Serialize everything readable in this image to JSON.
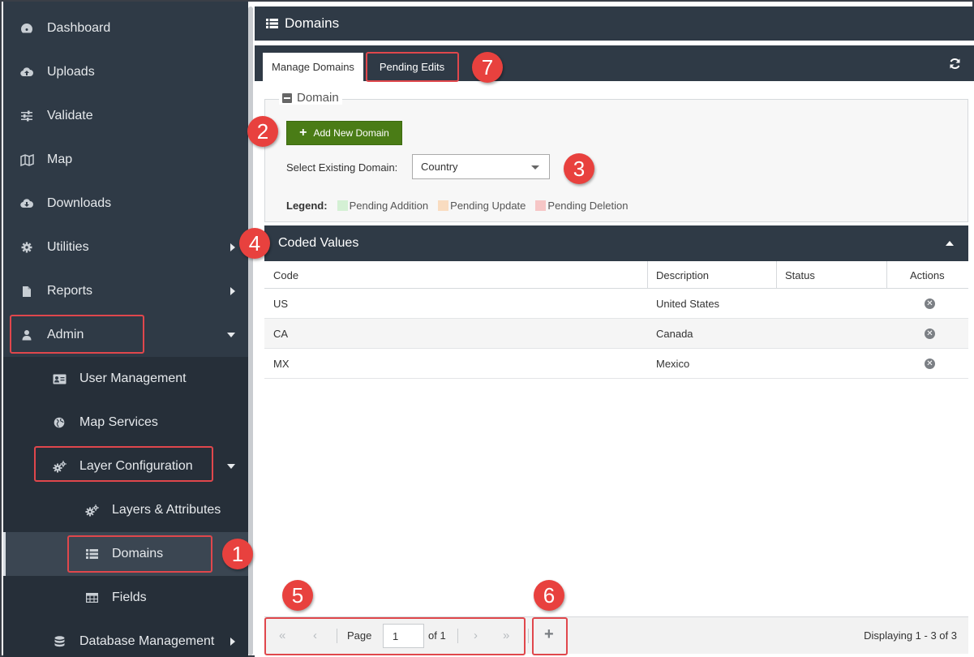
{
  "sidebar": {
    "cut_text": "ˇˇˇ ˇˇˇ",
    "items": [
      {
        "label": "Dashboard",
        "icon": "dashboard-icon"
      },
      {
        "label": "Uploads",
        "icon": "cloud-upload-icon"
      },
      {
        "label": "Validate",
        "icon": "sliders-icon"
      },
      {
        "label": "Map",
        "icon": "map-icon"
      },
      {
        "label": "Downloads",
        "icon": "cloud-download-icon"
      },
      {
        "label": "Utilities",
        "icon": "gear-icon"
      },
      {
        "label": "Reports",
        "icon": "file-icon"
      },
      {
        "label": "Admin",
        "icon": "user-icon"
      },
      {
        "label": "User Management",
        "icon": "id-card-icon"
      },
      {
        "label": "Map Services",
        "icon": "globe-icon"
      },
      {
        "label": "Layer Configuration",
        "icon": "gears-icon"
      },
      {
        "label": "Layers & Attributes",
        "icon": "gears-icon"
      },
      {
        "label": "Domains",
        "icon": "list-icon"
      },
      {
        "label": "Fields",
        "icon": "table-icon"
      },
      {
        "label": "Database Management",
        "icon": "database-icon"
      }
    ]
  },
  "header": {
    "title": "Domains"
  },
  "tabs": [
    {
      "label": "Manage Domains"
    },
    {
      "label": "Pending Edits"
    }
  ],
  "domain_panel": {
    "legend_title": "Domain",
    "add_button": "Add New Domain",
    "select_label": "Select Existing Domain:",
    "selected_value": "Country",
    "legend_label": "Legend:",
    "legend_items": [
      {
        "label": "Pending Addition",
        "color": "#d4f0d4"
      },
      {
        "label": "Pending Update",
        "color": "#f9dcc0"
      },
      {
        "label": "Pending Deletion",
        "color": "#f6c6c6"
      }
    ]
  },
  "coded_values": {
    "title": "Coded Values",
    "columns": [
      "Code",
      "Description",
      "Status",
      "Actions"
    ],
    "rows": [
      {
        "code": "US",
        "description": "United States",
        "status": ""
      },
      {
        "code": "CA",
        "description": "Canada",
        "status": ""
      },
      {
        "code": "MX",
        "description": "Mexico",
        "status": ""
      }
    ]
  },
  "pager": {
    "page_label": "Page",
    "page_value": "1",
    "of_label": "of 1",
    "display_text": "Displaying 1 - 3 of 3"
  },
  "callouts": [
    "1",
    "2",
    "3",
    "4",
    "5",
    "6",
    "7"
  ],
  "colors": {
    "sidebar_bg": "#2f3a46",
    "accent_green": "#4a7c16",
    "highlight_red": "#e0474c",
    "badge_red": "#e8413e"
  }
}
